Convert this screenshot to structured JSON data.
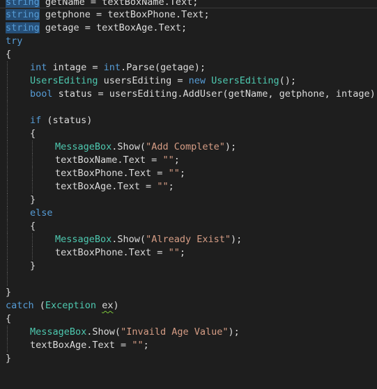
{
  "editor": {
    "lines": [
      {
        "indent": 0,
        "tokens": [
          {
            "t": "string",
            "c": "kw sel"
          },
          {
            "t": " getName = textBoxName.Text;",
            "c": "id"
          }
        ],
        "guides": [],
        "cursor": true
      },
      {
        "indent": 0,
        "tokens": [
          {
            "t": "string",
            "c": "kw sel"
          },
          {
            "t": " getphone = textBoxPhone.Text;",
            "c": "id"
          }
        ],
        "guides": []
      },
      {
        "indent": 0,
        "tokens": [
          {
            "t": "string",
            "c": "kw sel"
          },
          {
            "t": " getage = textBoxAge.Text;",
            "c": "id"
          }
        ],
        "guides": []
      },
      {
        "indent": 0,
        "tokens": [
          {
            "t": "try",
            "c": "kw"
          }
        ],
        "guides": []
      },
      {
        "indent": 0,
        "tokens": [
          {
            "t": "{",
            "c": "punc"
          }
        ],
        "guides": []
      },
      {
        "indent": 1,
        "tokens": [
          {
            "t": "int",
            "c": "kw"
          },
          {
            "t": " intage = ",
            "c": "id"
          },
          {
            "t": "int",
            "c": "kw"
          },
          {
            "t": ".Parse(getage);",
            "c": "id"
          }
        ],
        "guides": [
          10
        ]
      },
      {
        "indent": 1,
        "tokens": [
          {
            "t": "UsersEditing",
            "c": "type"
          },
          {
            "t": " usersEditing = ",
            "c": "id"
          },
          {
            "t": "new",
            "c": "kw"
          },
          {
            "t": " ",
            "c": "id"
          },
          {
            "t": "UsersEditing",
            "c": "type"
          },
          {
            "t": "();",
            "c": "id"
          }
        ],
        "guides": [
          10
        ]
      },
      {
        "indent": 1,
        "tokens": [
          {
            "t": "bool",
            "c": "kw"
          },
          {
            "t": " status = usersEditing.AddUser(getName, getphone, intage);",
            "c": "id"
          }
        ],
        "guides": [
          10
        ]
      },
      {
        "indent": 0,
        "tokens": [],
        "guides": [
          10
        ]
      },
      {
        "indent": 1,
        "tokens": [
          {
            "t": "if",
            "c": "kw"
          },
          {
            "t": " (status)",
            "c": "id"
          }
        ],
        "guides": [
          10
        ]
      },
      {
        "indent": 1,
        "tokens": [
          {
            "t": "{",
            "c": "punc"
          }
        ],
        "guides": [
          10
        ]
      },
      {
        "indent": 2,
        "tokens": [
          {
            "t": "MessageBox",
            "c": "type"
          },
          {
            "t": ".Show(",
            "c": "id"
          },
          {
            "t": "\"Add Complete\"",
            "c": "str"
          },
          {
            "t": ");",
            "c": "id"
          }
        ],
        "guides": [
          10,
          46
        ]
      },
      {
        "indent": 2,
        "tokens": [
          {
            "t": "textBoxName.Text = ",
            "c": "id"
          },
          {
            "t": "\"\"",
            "c": "str"
          },
          {
            "t": ";",
            "c": "id"
          }
        ],
        "guides": [
          10,
          46
        ]
      },
      {
        "indent": 2,
        "tokens": [
          {
            "t": "textBoxPhone.Text = ",
            "c": "id"
          },
          {
            "t": "\"\"",
            "c": "str"
          },
          {
            "t": ";",
            "c": "id"
          }
        ],
        "guides": [
          10,
          46
        ]
      },
      {
        "indent": 2,
        "tokens": [
          {
            "t": "textBoxAge.Text = ",
            "c": "id"
          },
          {
            "t": "\"\"",
            "c": "str"
          },
          {
            "t": ";",
            "c": "id"
          }
        ],
        "guides": [
          10,
          46
        ]
      },
      {
        "indent": 1,
        "tokens": [
          {
            "t": "}",
            "c": "punc"
          }
        ],
        "guides": [
          10
        ]
      },
      {
        "indent": 1,
        "tokens": [
          {
            "t": "else",
            "c": "kw"
          }
        ],
        "guides": [
          10
        ]
      },
      {
        "indent": 1,
        "tokens": [
          {
            "t": "{",
            "c": "punc"
          }
        ],
        "guides": [
          10
        ]
      },
      {
        "indent": 2,
        "tokens": [
          {
            "t": "MessageBox",
            "c": "type"
          },
          {
            "t": ".Show(",
            "c": "id"
          },
          {
            "t": "\"Already Exist\"",
            "c": "str"
          },
          {
            "t": ");",
            "c": "id"
          }
        ],
        "guides": [
          10,
          46
        ]
      },
      {
        "indent": 2,
        "tokens": [
          {
            "t": "textBoxPhone.Text = ",
            "c": "id"
          },
          {
            "t": "\"\"",
            "c": "str"
          },
          {
            "t": ";",
            "c": "id"
          }
        ],
        "guides": [
          10,
          46
        ]
      },
      {
        "indent": 1,
        "tokens": [
          {
            "t": "}",
            "c": "punc"
          }
        ],
        "guides": [
          10
        ]
      },
      {
        "indent": 0,
        "tokens": [],
        "guides": [
          10
        ]
      },
      {
        "indent": 0,
        "tokens": [
          {
            "t": "}",
            "c": "punc"
          }
        ],
        "guides": []
      },
      {
        "indent": 0,
        "tokens": [
          {
            "t": "catch",
            "c": "kw"
          },
          {
            "t": " (",
            "c": "id"
          },
          {
            "t": "Exception",
            "c": "type"
          },
          {
            "t": " ",
            "c": "id"
          },
          {
            "t": "ex",
            "c": "id squiggle"
          },
          {
            "t": ")",
            "c": "id"
          }
        ],
        "guides": []
      },
      {
        "indent": 0,
        "tokens": [
          {
            "t": "{",
            "c": "punc"
          }
        ],
        "guides": []
      },
      {
        "indent": 1,
        "tokens": [
          {
            "t": "MessageBox",
            "c": "type"
          },
          {
            "t": ".Show(",
            "c": "id"
          },
          {
            "t": "\"Invaild Age Value\"",
            "c": "str"
          },
          {
            "t": ");",
            "c": "id"
          }
        ],
        "guides": [
          10
        ]
      },
      {
        "indent": 1,
        "tokens": [
          {
            "t": "textBoxAge.Text = ",
            "c": "id"
          },
          {
            "t": "\"\"",
            "c": "str"
          },
          {
            "t": ";",
            "c": "id"
          }
        ],
        "guides": [
          10
        ]
      },
      {
        "indent": 0,
        "tokens": [
          {
            "t": "}",
            "c": "punc"
          }
        ],
        "guides": []
      }
    ]
  },
  "colors": {
    "background": "#1e1e1e",
    "keyword": "#569cd6",
    "type": "#4ec9b0",
    "string": "#d69d85",
    "identifier": "#dcdcdc",
    "selection": "#264f78"
  }
}
